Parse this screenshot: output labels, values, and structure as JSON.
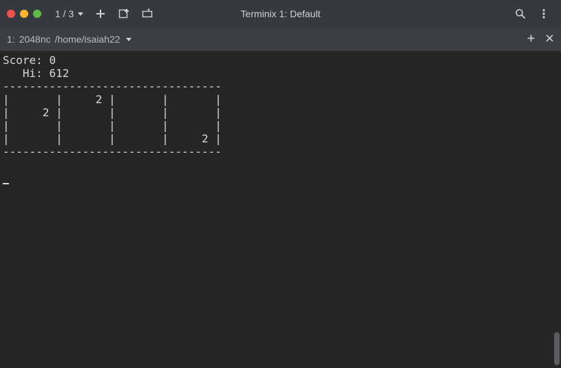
{
  "titlebar": {
    "tab_counter": "1 / 3",
    "title": "Terminix 1: Default"
  },
  "tabbar": {
    "index": "1:",
    "process": "2048nc",
    "cwd": "/home/isaiah22"
  },
  "game": {
    "score_label": "Score:",
    "score_value": "0",
    "hi_label": "Hi:",
    "hi_value": "612",
    "board": [
      [
        "",
        "2",
        "",
        ""
      ],
      [
        "2",
        "",
        "",
        ""
      ],
      [
        "",
        "",
        "",
        ""
      ],
      [
        "",
        "",
        "",
        "2"
      ]
    ]
  }
}
